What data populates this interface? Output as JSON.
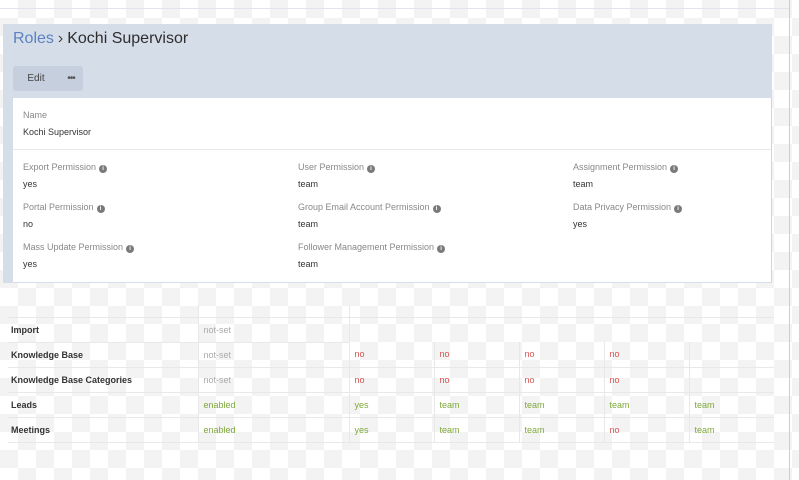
{
  "breadcrumb": {
    "parent": "Roles",
    "separator": "›",
    "current": "Kochi Supervisor"
  },
  "toolbar": {
    "edit_label": "Edit",
    "more_label": "•••"
  },
  "name_field": {
    "label": "Name",
    "value": "Kochi Supervisor"
  },
  "permissions": [
    {
      "label": "Export Permission",
      "value": "yes"
    },
    {
      "label": "User Permission",
      "value": "team"
    },
    {
      "label": "Assignment Permission",
      "value": "team"
    },
    {
      "label": "Portal Permission",
      "value": "no"
    },
    {
      "label": "Group Email Account Permission",
      "value": "team"
    },
    {
      "label": "Data Privacy Permission",
      "value": "yes"
    },
    {
      "label": "Mass Update Permission",
      "value": "yes"
    },
    {
      "label": "Follower Management Permission",
      "value": "team"
    }
  ],
  "info_icon": "info-icon",
  "scope_table": {
    "rows": [
      {
        "name": "Import",
        "access": "not-set",
        "values": []
      },
      {
        "name": "Knowledge Base",
        "access": "not-set",
        "values": [
          "no",
          "no",
          "no",
          "no",
          ""
        ]
      },
      {
        "name": "Knowledge Base Categories",
        "access": "not-set",
        "values": [
          "no",
          "no",
          "no",
          "no",
          ""
        ]
      },
      {
        "name": "Leads",
        "access": "enabled",
        "values": [
          "yes",
          "team",
          "team",
          "team",
          "team"
        ]
      },
      {
        "name": "Meetings",
        "access": "enabled",
        "values": [
          "yes",
          "team",
          "team",
          "no",
          "team"
        ]
      }
    ]
  },
  "colors": {
    "link": "#5b82c2",
    "enabled": "#7fa83a",
    "negative": "#d9534f",
    "muted": "#aaaaaa",
    "header_bg": "#d5dde9"
  }
}
